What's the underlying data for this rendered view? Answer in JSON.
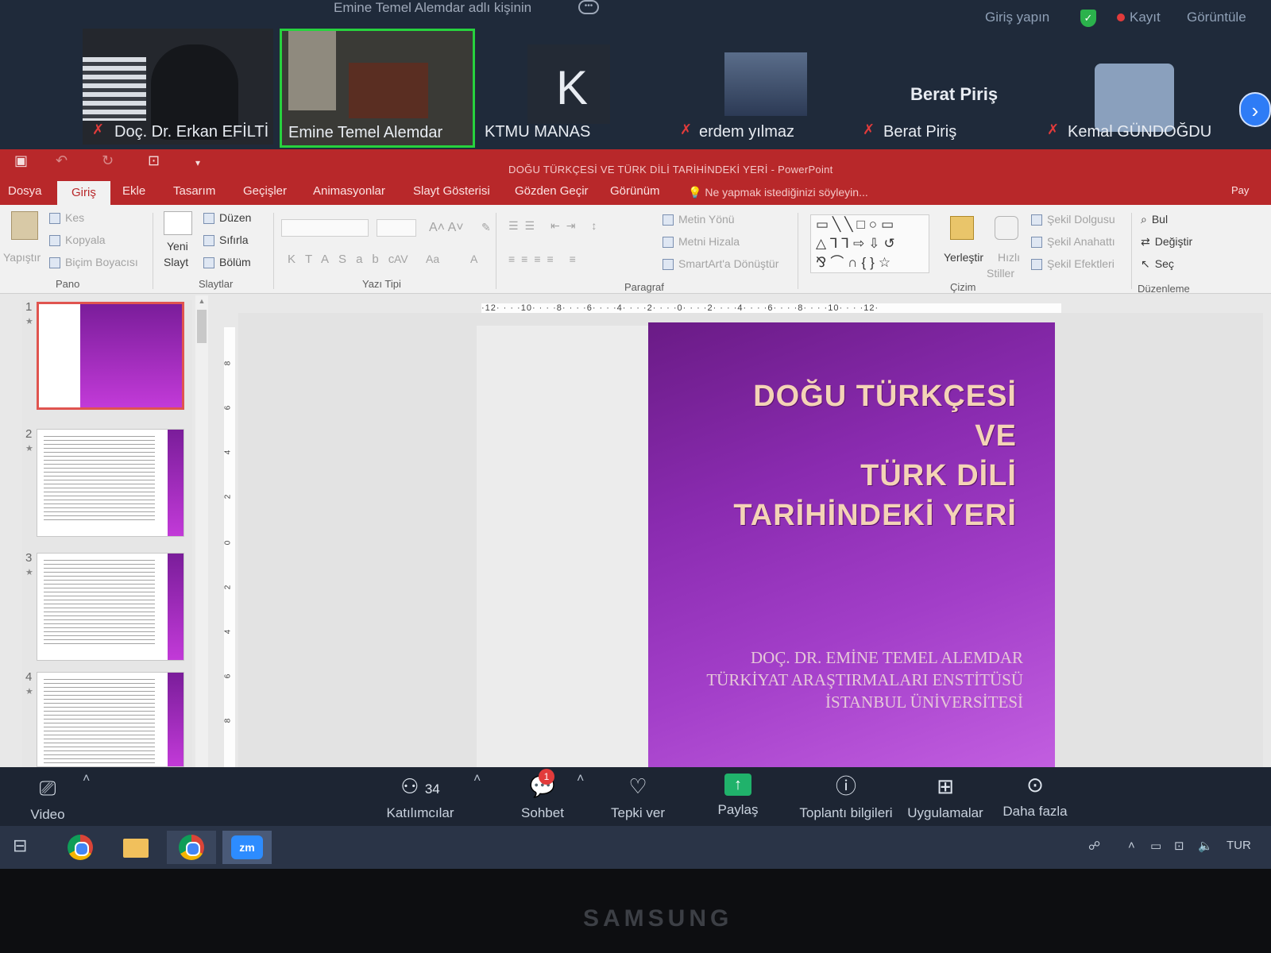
{
  "zoom_top": {
    "speaking": "Emine Temel Alemdar adlı kişinin",
    "sign_in": "Giriş yapın",
    "record": "Kayıt",
    "view": "Görüntüle",
    "participants": [
      {
        "name": "Doç. Dr. Erkan EFİLTİ",
        "muted": true
      },
      {
        "name": "Emine Temel Alemdar",
        "muted": false,
        "active": true
      },
      {
        "name": "KTMU MANAS",
        "initial": "K"
      },
      {
        "name": "erdem yılmaz",
        "muted": true
      },
      {
        "name": "Berat Piriş",
        "label": "Berat Piriş",
        "muted": true
      },
      {
        "name": "Kemal GÜNDOĞDU",
        "muted": true
      }
    ]
  },
  "ppt": {
    "window_title": "DOĞU TÜRKÇESİ VE TÜRK DİLİ TARİHİNDEKİ YERİ - PowerPoint",
    "tabs": [
      "Dosya",
      "Giriş",
      "Ekle",
      "Tasarım",
      "Geçişler",
      "Animasyonlar",
      "Slayt Gösterisi",
      "Gözden Geçir",
      "Görünüm"
    ],
    "tell_me": "Ne yapmak istediğinizi söyleyin...",
    "ribbon": {
      "paste": "Yapıştır",
      "cut": "Kes",
      "copy": "Kopyala",
      "format_painter": "Biçim Boyacısı",
      "group_clipboard": "Pano",
      "new_slide": "Yeni",
      "new_slide2": "Slayt",
      "layout": "Düzen",
      "reset": "Sıfırla",
      "section": "Bölüm",
      "group_slides": "Slaytlar",
      "group_font": "Yazı Tipi",
      "text_direction": "Metin Yönü",
      "align_text": "Metni Hizala",
      "smartart": "SmartArt'a Dönüştür",
      "group_paragraph": "Paragraf",
      "arrange": "Yerleştir",
      "quick_styles": "Hızlı",
      "quick_styles2": "Stiller",
      "shape_fill": "Şekil Dolgusu",
      "shape_outline": "Şekil Anahattı",
      "shape_effects": "Şekil Efektleri",
      "group_drawing": "Çizim",
      "find": "Bul",
      "replace": "Değiştir",
      "select": "Seç",
      "group_editing": "Düzenleme",
      "share_corner": "Pay"
    },
    "ruler_h": "·12· · · ·10· · · ·8· · · ·6· · · ·4· · · ·2· · · ·0· · · ·2· · · ·4· · · ·6· · · ·8· · · ·10· · · ·12·",
    "ruler_v": [
      "8",
      "6",
      "4",
      "2",
      "0",
      "2",
      "4",
      "6",
      "8"
    ],
    "thumb_numbers": [
      "1",
      "2",
      "3",
      "4"
    ],
    "slide": {
      "title_lines": [
        "DOĞU TÜRKÇESİ",
        "VE",
        "TÜRK DİLİ",
        "TARİHİNDEKİ YERİ"
      ],
      "subtitle_lines": [
        "DOÇ. DR. EMİNE TEMEL ALEMDAR",
        "TÜRKİYAT ARAŞTIRMALARI ENSTİTÜSÜ",
        "İSTANBUL ÜNİVERSİTESİ"
      ]
    }
  },
  "zoom_controls": {
    "video": "Video",
    "participants_count": "34",
    "participants": "Katılımcılar",
    "chat": "Sohbet",
    "chat_badge": "1",
    "react": "Tepki ver",
    "share": "Paylaş",
    "meeting_info": "Toplantı bilgileri",
    "apps": "Uygulamalar",
    "more": "Daha fazla"
  },
  "taskbar": {
    "zoom_label": "zm",
    "lang": "TUR"
  },
  "monitor_brand": "SAMSUNG"
}
